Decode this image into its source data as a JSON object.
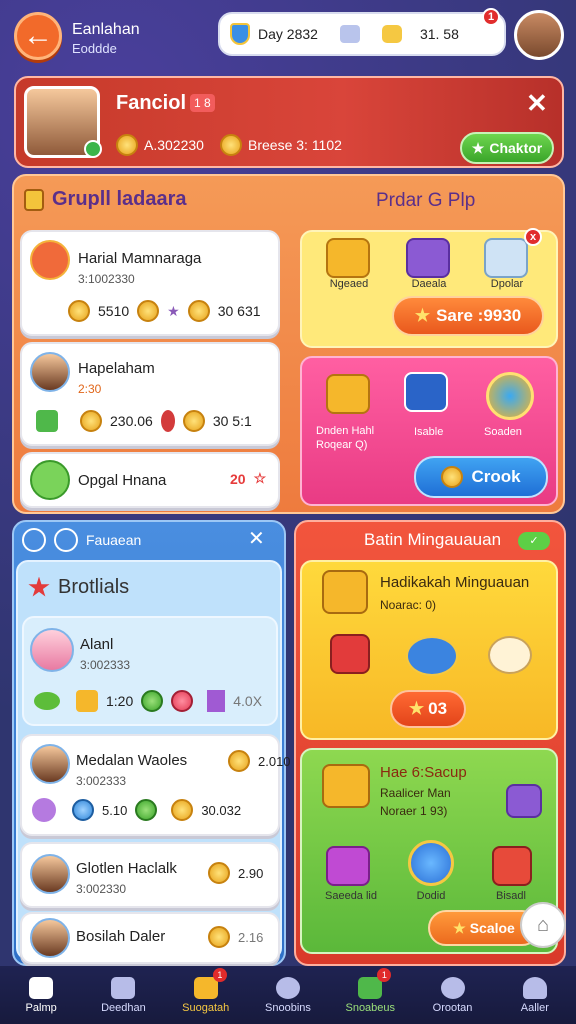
{
  "header": {
    "back_glyph": "←",
    "title": "Eanlahan",
    "subtitle": "Eoddde",
    "day_label": "Day 2832",
    "coins_value": "31. 58",
    "notif_count": "1"
  },
  "banner": {
    "name": "Fanciol",
    "level": "1 8",
    "stat1": "A.302230",
    "stat2": "Breese 3: 1102",
    "chat_label": "Chaktor"
  },
  "group_panel": {
    "title": "Grupll ladaara",
    "pro_title": "Prdar G Plp",
    "rows": [
      {
        "name": "Harial Mamnaraga",
        "sub": "3:1002330",
        "vals": [
          "5510",
          "30 631"
        ]
      },
      {
        "name": "Hapelaham",
        "sub": "2:30",
        "vals": [
          "230.06",
          "30 5:1"
        ]
      },
      {
        "name": "Opgal Hnana",
        "sub": "",
        "vals": [
          "20"
        ]
      }
    ],
    "gift_labels": [
      "Ngeaed",
      "Daeala",
      "Dpolar"
    ],
    "score_btn": "Sare :9930",
    "pink_text1": "Dnden Hahl",
    "pink_text2": "Roqear Q)",
    "pink_label2": "Isable",
    "pink_label3": "Soaden",
    "crook_btn": "Crook"
  },
  "lower_left": {
    "head_label": "Fauaean",
    "subtitle": "Brotlials",
    "items": [
      {
        "name": "Alanl",
        "sub": "3:002333",
        "vals": [
          "1:20",
          "4.0X"
        ]
      },
      {
        "name": "Medalan Waoles",
        "sub": "3:002333",
        "vals": [
          "2.010",
          "5.10",
          "30.032"
        ]
      },
      {
        "name": "Glotlen Haclalk",
        "sub": "3:002330",
        "vals": [
          "2.90"
        ]
      },
      {
        "name": "Bosilah Daler",
        "sub": "",
        "vals": [
          "2.16"
        ]
      }
    ]
  },
  "lower_right": {
    "title": "Batin Mingauauan",
    "toggle": "✓",
    "y_name": "Hadikakah Minguauan",
    "y_sub": "Noarac: 0)",
    "y_score": "03",
    "g_name": "Hae 6:Sacup",
    "g_sub1": "Raalicer Man",
    "g_sub2": "Noraer 1 93)",
    "g_labels": [
      "Saeeda lid",
      "Dodid",
      "Bisadl"
    ],
    "g_btn": "Scaloe"
  },
  "bottom_nav": {
    "items": [
      "Palmp",
      "Deedhan",
      "Suogatah",
      "Snoobins",
      "Snoabeus",
      "Orootan",
      "Aaller"
    ]
  },
  "colors": {
    "accent_orange": "#f26a2a",
    "panel_blue": "#2e70c7",
    "panel_red": "#d93a2a",
    "green": "#3aa52a"
  }
}
